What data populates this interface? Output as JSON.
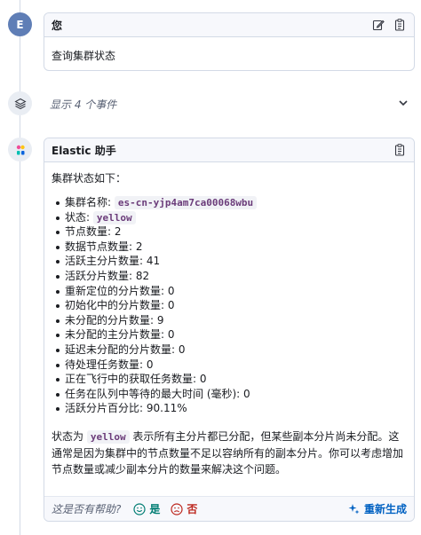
{
  "user_message": {
    "avatar_initial": "E",
    "author": "您",
    "text": "查询集群状态"
  },
  "events": {
    "label": "显示 4 个事件"
  },
  "assistant_message": {
    "author": "Elastic 助手",
    "intro": "集群状态如下：",
    "items": [
      {
        "label": "集群名称: ",
        "code": "es-cn-yjp4am7ca00068wbu"
      },
      {
        "label": "状态: ",
        "code": "yellow"
      },
      {
        "label": "节点数量: 2"
      },
      {
        "label": "数据节点数量: 2"
      },
      {
        "label": "活跃主分片数量: 41"
      },
      {
        "label": "活跃分片数量: 82"
      },
      {
        "label": "重新定位的分片数量: 0"
      },
      {
        "label": "初始化中的分片数量: 0"
      },
      {
        "label": "未分配的分片数量: 9"
      },
      {
        "label": "未分配的主分片数量: 0"
      },
      {
        "label": "延迟未分配的分片数量: 0"
      },
      {
        "label": "待处理任务数量: 0"
      },
      {
        "label": "正在飞行中的获取任务数量: 0"
      },
      {
        "label": "任务在队列中等待的最大时间 (毫秒): 0"
      },
      {
        "label": "活跃分片百分比: 90.11%"
      }
    ],
    "summary_prefix": "状态为 ",
    "summary_code": "yellow",
    "summary_suffix": " 表示所有主分片都已分配，但某些副本分片尚未分配。这通常是因为集群中的节点数量不足以容纳所有的副本分片。你可以考虑增加节点数量或减少副本分片的数量来解决这个问题。"
  },
  "footer": {
    "question": "这是否有帮助?",
    "yes_label": "是",
    "no_label": "否",
    "regenerate_label": "重新生成"
  },
  "colors": {
    "user_avatar": "#5f7eb6",
    "yes": "#017d73",
    "no": "#bd271e",
    "link": "#0061c2"
  }
}
